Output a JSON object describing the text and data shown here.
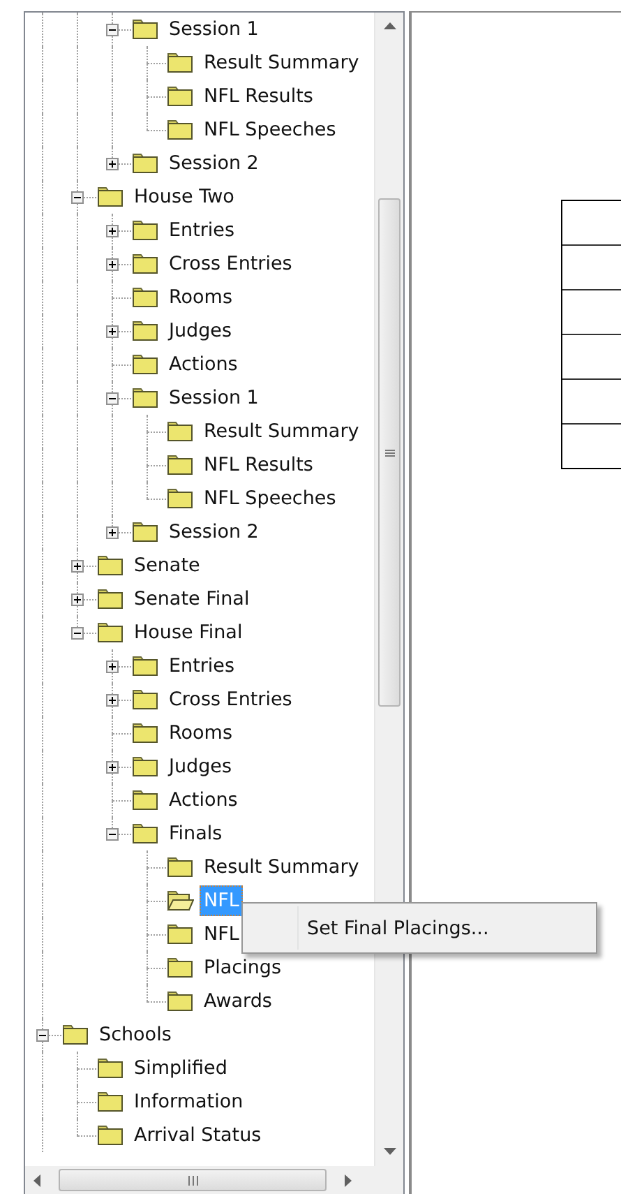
{
  "tree": {
    "items": [
      {
        "children": [
          {
            "children": [
              {
                "label": "Session 1",
                "expanded": true,
                "selected": false,
                "children": [
                  {
                    "label": "Result Summary",
                    "selected": false
                  },
                  {
                    "label": "NFL Results",
                    "selected": false
                  },
                  {
                    "label": "NFL Speeches",
                    "selected": false
                  }
                ]
              },
              {
                "label": "Session 2",
                "expanded": false,
                "selected": false
              }
            ]
          },
          {
            "label": "House Two",
            "expanded": true,
            "selected": false,
            "children": [
              {
                "label": "Entries",
                "expanded": false,
                "selected": false
              },
              {
                "label": "Cross Entries",
                "expanded": false,
                "selected": false
              },
              {
                "label": "Rooms",
                "selected": false
              },
              {
                "label": "Judges",
                "expanded": false,
                "selected": false
              },
              {
                "label": "Actions",
                "selected": false
              },
              {
                "label": "Session 1",
                "expanded": true,
                "selected": false,
                "children": [
                  {
                    "label": "Result Summary",
                    "selected": false
                  },
                  {
                    "label": "NFL Results",
                    "selected": false
                  },
                  {
                    "label": "NFL Speeches",
                    "selected": false
                  }
                ]
              },
              {
                "label": "Session 2",
                "expanded": false,
                "selected": false
              }
            ]
          },
          {
            "label": "Senate",
            "expanded": false,
            "selected": false
          },
          {
            "label": "Senate Final",
            "expanded": false,
            "selected": false
          },
          {
            "label": "House Final",
            "expanded": true,
            "selected": false,
            "children": [
              {
                "label": "Entries",
                "expanded": false,
                "selected": false
              },
              {
                "label": "Cross Entries",
                "expanded": false,
                "selected": false
              },
              {
                "label": "Rooms",
                "selected": false
              },
              {
                "label": "Judges",
                "expanded": false,
                "selected": false
              },
              {
                "label": "Actions",
                "selected": false
              },
              {
                "label": "Finals",
                "expanded": true,
                "selected": false,
                "children": [
                  {
                    "label": "Result Summary",
                    "selected": false
                  },
                  {
                    "label": "NFL",
                    "selected": true
                  },
                  {
                    "label": "NFL",
                    "selected": false
                  },
                  {
                    "label": "Placings",
                    "selected": false
                  },
                  {
                    "label": "Awards",
                    "selected": false
                  }
                ]
              }
            ]
          }
        ]
      },
      {
        "label": "Schools",
        "expanded": true,
        "selected": false,
        "children": [
          {
            "label": "Simplified",
            "selected": false
          },
          {
            "label": "Information",
            "selected": false
          },
          {
            "label": "Arrival Status",
            "selected": false
          }
        ]
      }
    ]
  },
  "context_menu": {
    "items": [
      "Set Final Placings..."
    ]
  }
}
